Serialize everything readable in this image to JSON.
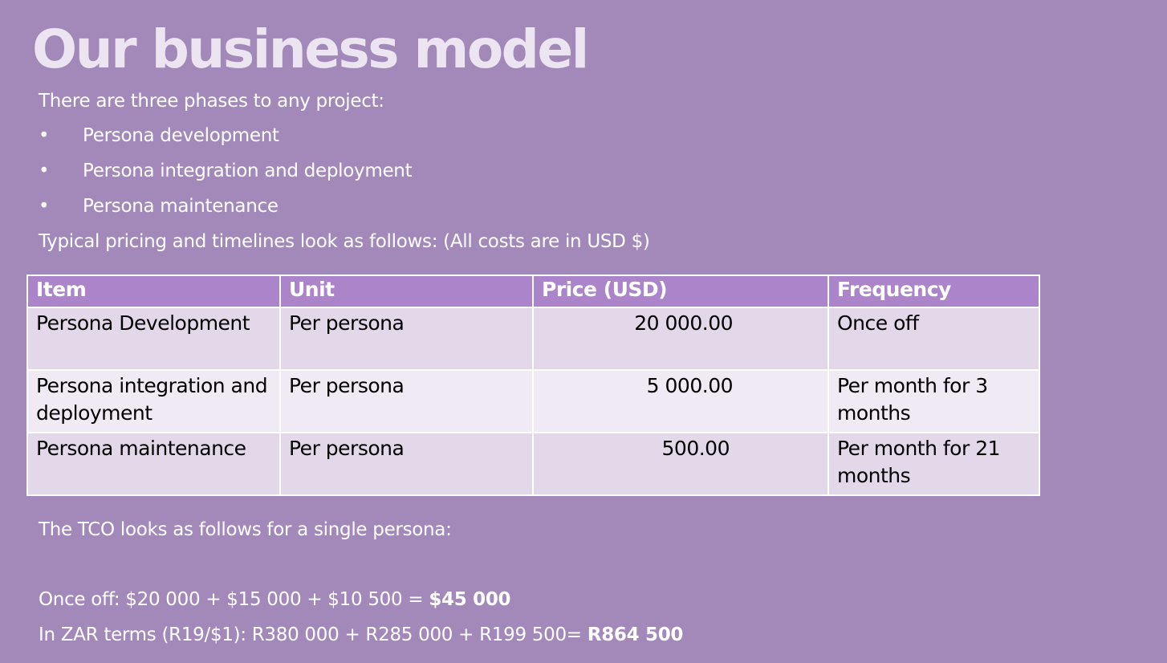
{
  "slide": {
    "title": "Our business model",
    "intro": "There are three phases to any project:",
    "bullet_symbol": "•",
    "phases": [
      "Persona development",
      "Persona integration and deployment",
      "Persona maintenance"
    ],
    "pricing_intro": "Typical pricing and timelines look as follows: (All costs are in USD $)"
  },
  "table": {
    "headers": [
      "Item",
      "Unit",
      "Price (USD)",
      "Frequency"
    ],
    "rows": [
      {
        "item": "Persona Development",
        "unit": "Per persona",
        "price": "20 000.00",
        "frequency": "Once off"
      },
      {
        "item": "Persona integration and deployment",
        "unit": "Per persona",
        "price": "5 000.00",
        "frequency": "Per month for 3 months"
      },
      {
        "item": "Persona maintenance",
        "unit": "Per persona",
        "price": "500.00",
        "frequency": "Per month for 21 months"
      }
    ]
  },
  "tco": {
    "intro": "The TCO looks as follows for a single persona:",
    "usd_prefix": "Once off: $20 000 + $15 000 + $10 500 = ",
    "usd_total": "$45 000",
    "zar_prefix": "In ZAR terms (R19/$1): R380 000 + R285 000 + R199 500= ",
    "zar_total": "R864 500"
  },
  "colors": {
    "background": "#a388ba",
    "title": "#ece4f1",
    "table_header": "#ab84c9",
    "table_row_odd": "#e3d8ea",
    "table_row_even": "#efeaf3"
  }
}
